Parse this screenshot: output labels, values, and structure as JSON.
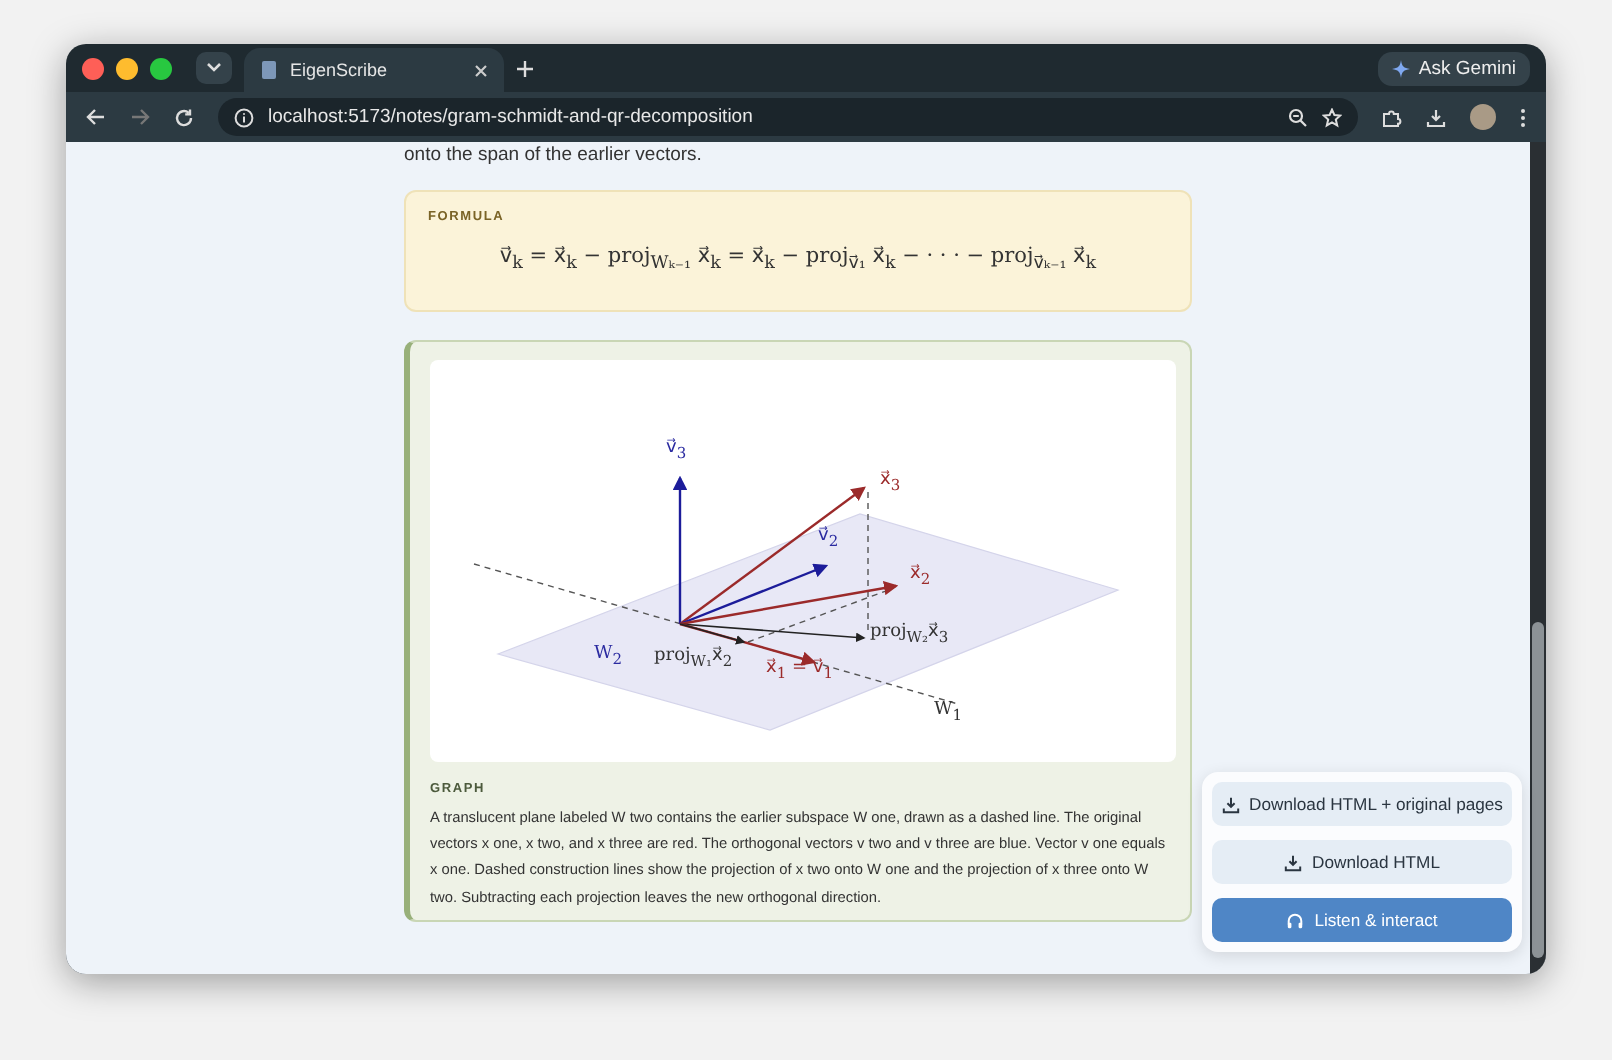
{
  "browser": {
    "tab_title": "EigenScribe",
    "url": "localhost:5173/notes/gram-schmidt-and-qr-decomposition",
    "assistant_button": "Ask Gemini"
  },
  "content": {
    "intro_text": "onto the span of the earlier vectors.",
    "formula": {
      "label": "FORMULA",
      "expression": "v⃗$_{k}$ = x⃗$_{k}$ − proj$_{Wₖ₋₁}$ x⃗$_{k}$ = x⃗$_{k}$ − proj$_{v⃗₁}$ x⃗$_{k}$ − · · · − proj$_{v⃗ₖ₋₁}$ x⃗$_{k}$"
    },
    "graph": {
      "label": "GRAPH",
      "diagram_labels": [
        {
          "kind": "blue",
          "text": "v⃗$_{3}$"
        },
        {
          "kind": "red",
          "text": "x⃗$_{3}$"
        },
        {
          "kind": "blue",
          "text": "v⃗$_{2}$"
        },
        {
          "kind": "red",
          "text": "x⃗$_{2}$"
        },
        {
          "kind": "black",
          "text": "proj$_{W₂}$x⃗$_{3}$"
        },
        {
          "kind": "blue",
          "text": "W$_{2}$"
        },
        {
          "kind": "black",
          "text": "proj$_{W₁}$x⃗$_{2}$"
        },
        {
          "kind": "red",
          "text": "x⃗$_{1}$ = v⃗$_{1}$"
        },
        {
          "kind": "black",
          "text": "W$_{1}$"
        }
      ],
      "description": "A translucent plane labeled W two contains the earlier subspace W one, drawn as a dashed line. The original vectors x one, x two, and x three are red. The orthogonal vectors v two and v three are blue. Vector v one equals x one. Dashed construction lines show the projection of x two onto W one and the projection of x three onto W two. Subtracting each projection leaves the new orthogonal direction."
    }
  },
  "actions": [
    {
      "kind": "download",
      "label": "Download HTML + original pages"
    },
    {
      "kind": "download",
      "label": "Download HTML"
    },
    {
      "kind": "listen",
      "label": "Listen & interact"
    }
  ]
}
